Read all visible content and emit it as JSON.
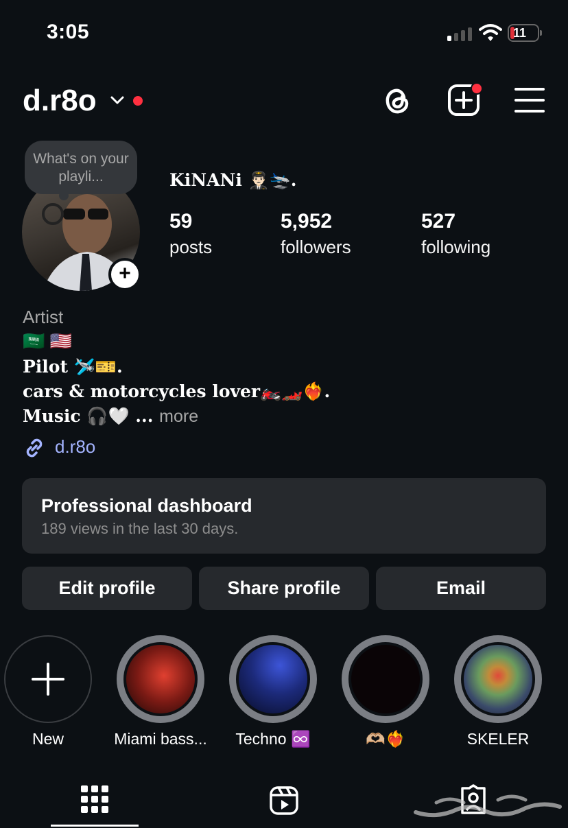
{
  "status_bar": {
    "time": "3:05",
    "battery": "11"
  },
  "header": {
    "username": "d.r8o"
  },
  "note": {
    "text": "What's on your playli..."
  },
  "profile": {
    "display_name": "KiNANi 👨🏻‍✈️🛬.",
    "stats": [
      {
        "value": "59",
        "label": "posts"
      },
      {
        "value": "5,952",
        "label": "followers"
      },
      {
        "value": "527",
        "label": "following"
      }
    ],
    "category": "Artist",
    "flags": "🇸🇦 🇺🇸",
    "bio_lines": [
      "Pilot 🛩️🎫.",
      "cars & motorcycles lover🏍️🏎️❤️‍🔥.",
      "Music 🎧🤍 ..."
    ],
    "more_label": "more",
    "link": "d.r8o"
  },
  "dashboard": {
    "title": "Professional dashboard",
    "subtitle": "189 views in the last 30 days."
  },
  "buttons": {
    "edit": "Edit profile",
    "share": "Share profile",
    "email": "Email"
  },
  "highlights": [
    {
      "label": "New",
      "kind": "new",
      "icon": "plus-icon"
    },
    {
      "label": "Miami bass...",
      "kind": "story",
      "thumb_color": "#b02a24"
    },
    {
      "label": "Techno ♾️",
      "kind": "story",
      "thumb_color": "#1c2f8f"
    },
    {
      "label": "🫶🏼❤️‍🔥",
      "kind": "story",
      "thumb_color": "#0a0406"
    },
    {
      "label": "SKELER",
      "kind": "story",
      "thumb_color": "#6a8c5a"
    }
  ],
  "tabs": [
    {
      "name": "posts-grid",
      "icon": "grid-icon",
      "active": true
    },
    {
      "name": "reels",
      "icon": "reels-icon",
      "active": false
    },
    {
      "name": "tagged",
      "icon": "tagged-icon",
      "active": false
    }
  ],
  "colors": {
    "background": "#0c1014",
    "accent_red": "#ff3040",
    "link_blue": "#a4b4ff",
    "card": "#26292d"
  }
}
